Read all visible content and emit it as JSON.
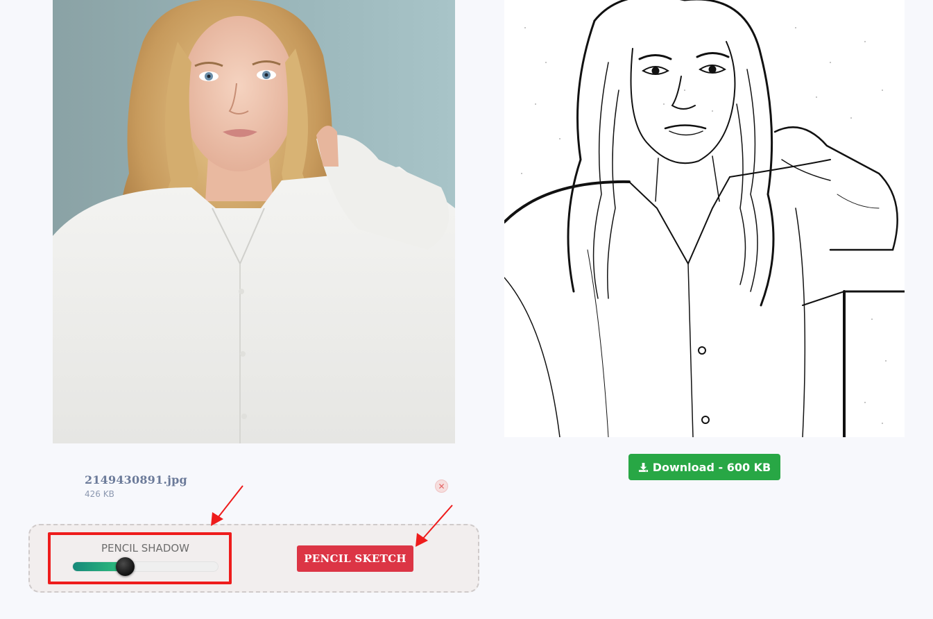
{
  "original_photo": {
    "icon": "portrait-photo"
  },
  "sketch_photo": {
    "icon": "pencil-sketch-portrait"
  },
  "download": {
    "label": "Download - 600 KB",
    "icon": "download-icon",
    "color": "#28a745"
  },
  "file": {
    "name": "2149430891.jpg",
    "size": "426 KB",
    "remove_icon": "close-icon"
  },
  "controls": {
    "shadow_label": "PENCIL SHADOW",
    "shadow_level_percent": 36,
    "sketch_button_label": "PENCIL SKETCH",
    "sketch_button_color": "#dc3545",
    "highlight_color": "#ee1c1c"
  }
}
